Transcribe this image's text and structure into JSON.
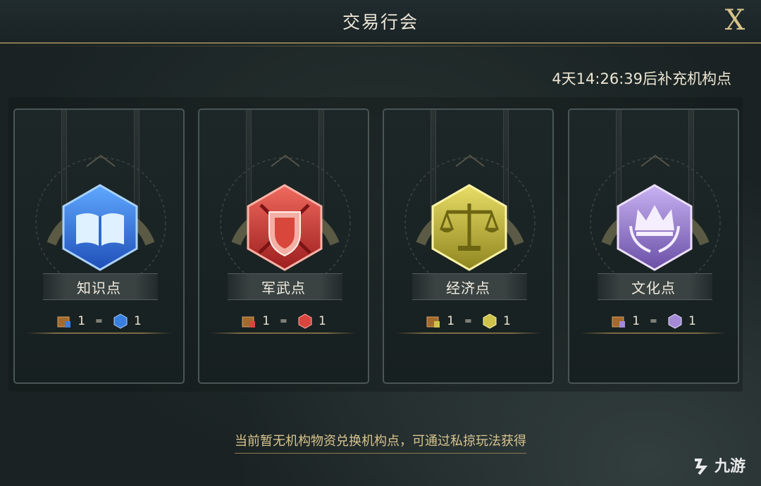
{
  "header": {
    "title": "交易行会",
    "close_label": "X"
  },
  "timer_text": "4天14:26:39后补充机构点",
  "cards": [
    {
      "label": "知识点",
      "rate_left": "1",
      "rate_eq": "=",
      "rate_right": "1",
      "color": "#3a7fe0",
      "icon": "book-icon"
    },
    {
      "label": "军武点",
      "rate_left": "1",
      "rate_eq": "=",
      "rate_right": "1",
      "color": "#d8453f",
      "icon": "shield-swords-icon"
    },
    {
      "label": "经济点",
      "rate_left": "1",
      "rate_eq": "=",
      "rate_right": "1",
      "color": "#cfc24a",
      "icon": "scales-icon"
    },
    {
      "label": "文化点",
      "rate_left": "1",
      "rate_eq": "=",
      "rate_right": "1",
      "color": "#a48ad6",
      "icon": "crown-wreath-icon"
    }
  ],
  "hint_text": "当前暂无机构物资兑换机构点，可通过私掠玩法获得",
  "watermark_text": "九游"
}
